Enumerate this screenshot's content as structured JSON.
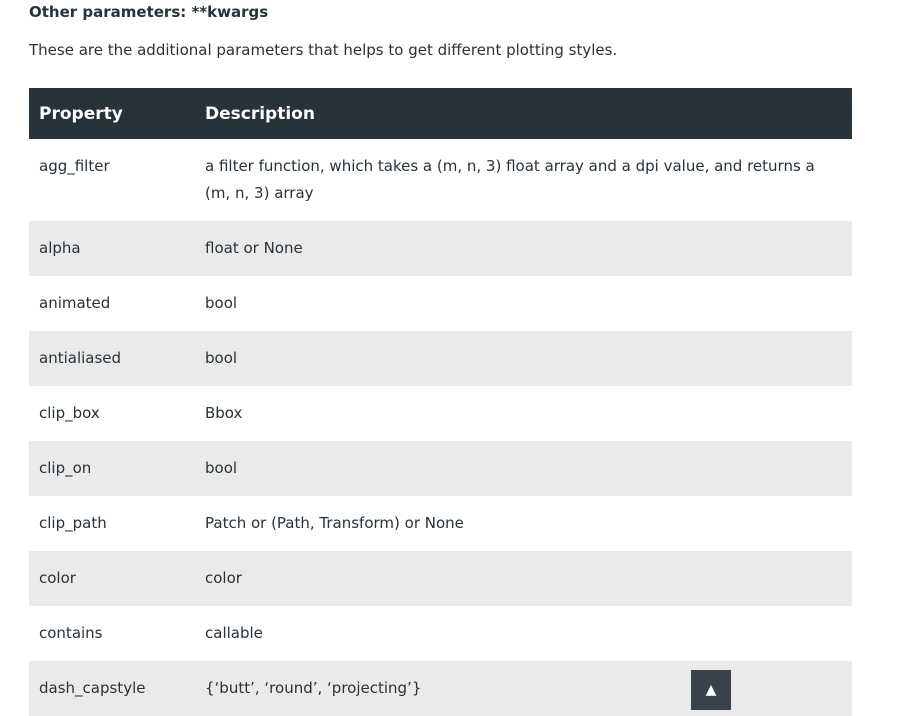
{
  "heading": "Other parameters: **kwargs",
  "intro": "These are the additional parameters that helps to get different plotting styles.",
  "table": {
    "headers": [
      "Property",
      "Description"
    ],
    "rows": [
      {
        "property": "agg_filter",
        "description": "a filter function, which takes a (m, n, 3) float array and a dpi value, and returns a (m, n, 3) array"
      },
      {
        "property": "alpha",
        "description": "float or None"
      },
      {
        "property": "animated",
        "description": "bool"
      },
      {
        "property": "antialiased",
        "description": "bool"
      },
      {
        "property": "clip_box",
        "description": "Bbox"
      },
      {
        "property": "clip_on",
        "description": "bool"
      },
      {
        "property": "clip_path",
        "description": "Patch or (Path, Transform) or None"
      },
      {
        "property": "color",
        "description": "color"
      },
      {
        "property": "contains",
        "description": "callable"
      },
      {
        "property": "dash_capstyle",
        "description": "{‘butt’, ‘round’, ‘projecting’}"
      }
    ]
  },
  "scroll_top": {
    "icon": "up-arrow-icon",
    "glyph": "▲"
  },
  "colors": {
    "header_bg": "#273239",
    "row_alt_bg": "#eaeaea",
    "text": "#273239",
    "scroll_button_bg": "#3a4148"
  }
}
